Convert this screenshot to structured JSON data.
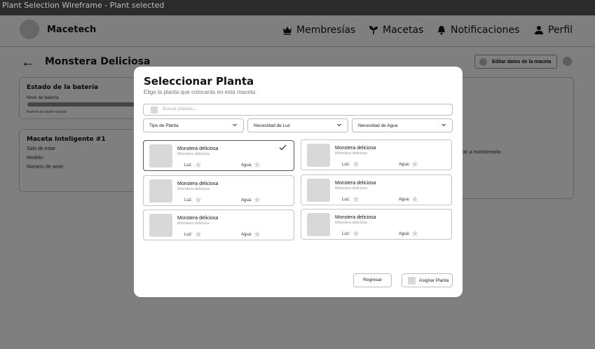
{
  "window": {
    "title": "Plant Selection Wireframe - Plant selected"
  },
  "nav": {
    "brand": "Macetech",
    "items": [
      {
        "label": "Membresías",
        "icon": "crown-icon"
      },
      {
        "label": "Macetas",
        "icon": "sprout-icon"
      },
      {
        "label": "Notificaciones",
        "icon": "bell-icon"
      },
      {
        "label": "Perfil",
        "icon": "user-icon"
      }
    ]
  },
  "page": {
    "title": "Monstera Deliciosa",
    "edit_button": "Editar datos de la maceta"
  },
  "battery_card": {
    "title": "Estado de la batería",
    "level_label": "Nivel de batería",
    "status": "Batería en buen estado"
  },
  "pot_card": {
    "title": "Maceta Inteligente #1",
    "location": "Sala de estar",
    "model_label": "Modelo:",
    "serial_label": "Número de serie:"
  },
  "monitor_card": {
    "text_fragment": "enzar a monitorearla."
  },
  "modal": {
    "title": "Seleccionar Planta",
    "subtitle": "Elige la planta que colocarás en esta maceta",
    "search_placeholder": "Buscar plantas...",
    "filters": [
      "Tipo de Planta",
      "Necesidad de Luz",
      "Necesidad de Agua"
    ],
    "plants": [
      {
        "name": "Monstera deliciosa",
        "scientific": "Monstera deliciosa",
        "luz_label": "Luz:",
        "agua_label": "Agua:",
        "selected": true
      },
      {
        "name": "Monstera deliciosa",
        "scientific": "Monstera deliciosa",
        "luz_label": "Luz:",
        "agua_label": "Agua:",
        "selected": false
      },
      {
        "name": "Monstera deliciosa",
        "scientific": "Monstera deliciosa",
        "luz_label": "Luz:",
        "agua_label": "Agua:",
        "selected": false
      },
      {
        "name": "Monstera deliciosa",
        "scientific": "Monstera deliciosa",
        "luz_label": "Luz:",
        "agua_label": "Agua:",
        "selected": false
      },
      {
        "name": "Monstera deliciosa",
        "scientific": "Monstera deliciosa",
        "luz_label": "Luz:",
        "agua_label": "Agua:",
        "selected": false
      },
      {
        "name": "Monstera deliciosa",
        "scientific": "Monstera deliciosa",
        "luz_label": "Luz:",
        "agua_label": "Agua:",
        "selected": false
      }
    ],
    "back_button": "Regresar",
    "assign_button": "Asignar Planta"
  }
}
